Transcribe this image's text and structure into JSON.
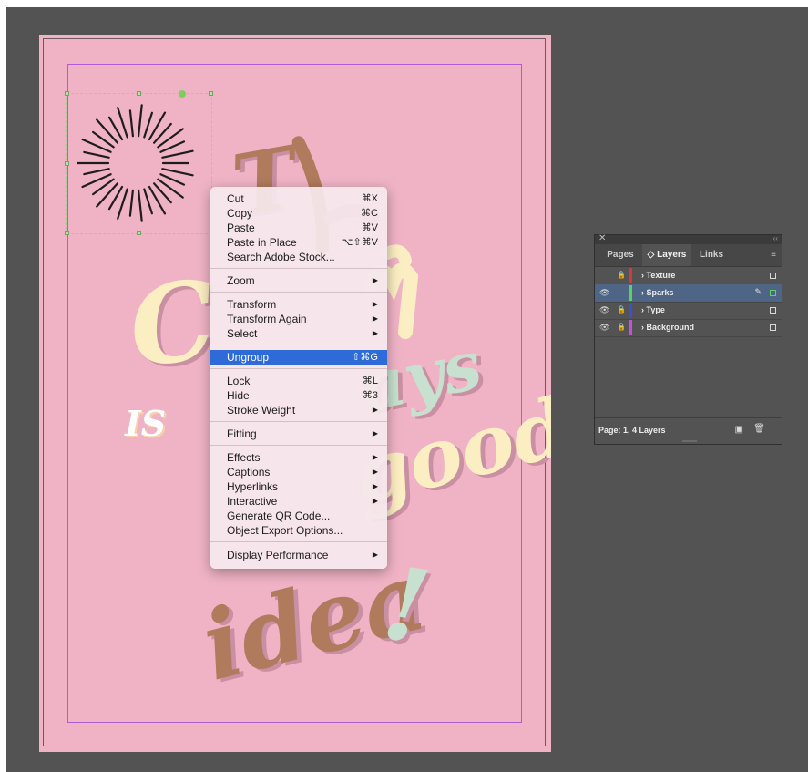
{
  "context_menu": {
    "items": [
      {
        "label": "Cut",
        "shortcut": "⌘X"
      },
      {
        "label": "Copy",
        "shortcut": "⌘C"
      },
      {
        "label": "Paste",
        "shortcut": "⌘V"
      },
      {
        "label": "Paste in Place",
        "shortcut": "⌥⇧⌘V"
      },
      {
        "label": "Search Adobe Stock..."
      },
      {
        "label": "Zoom",
        "submenu": true
      },
      {
        "label": "Transform",
        "submenu": true
      },
      {
        "label": "Transform Again",
        "submenu": true
      },
      {
        "label": "Select",
        "submenu": true
      },
      {
        "label": "Ungroup",
        "shortcut": "⇧⌘G",
        "highlighted": true
      },
      {
        "label": "Lock",
        "shortcut": "⌘L"
      },
      {
        "label": "Hide",
        "shortcut": "⌘3"
      },
      {
        "label": "Stroke Weight",
        "submenu": true
      },
      {
        "label": "Fitting",
        "submenu": true
      },
      {
        "label": "Effects",
        "submenu": true
      },
      {
        "label": "Captions",
        "submenu": true
      },
      {
        "label": "Hyperlinks",
        "submenu": true
      },
      {
        "label": "Interactive",
        "submenu": true
      },
      {
        "label": "Generate QR Code..."
      },
      {
        "label": "Object Export Options..."
      },
      {
        "label": "Display Performance",
        "submenu": true
      }
    ],
    "submenu_arrow": "▶"
  },
  "layers_panel": {
    "close_icon": "✕",
    "collapse_icon": "‹‹",
    "menu_icon": "≡",
    "tabs": [
      "Pages",
      "◇ Layers",
      "Links"
    ],
    "active_tab": "◇ Layers",
    "layers": [
      {
        "name": "Texture",
        "color": "#d13b3b",
        "visible": false,
        "locked": true,
        "selected": false
      },
      {
        "name": "Sparks",
        "color": "#5ad35a",
        "visible": true,
        "locked": false,
        "selected": true
      },
      {
        "name": "Type",
        "color": "#3a4fd6",
        "visible": true,
        "locked": true,
        "selected": false
      },
      {
        "name": "Background",
        "color": "#c84fd8",
        "visible": true,
        "locked": true,
        "selected": false
      }
    ],
    "footer": "Page: 1, 4 Layers",
    "icons": {
      "eye": "👁",
      "lock": "🔒",
      "chevron": "›",
      "pencil": "✎",
      "new_layer": "▣",
      "trash": "🗑"
    }
  },
  "artwork": {
    "page_color": "#f0b3c6",
    "cream": "#fbeec2",
    "mint": "#c8e0cf",
    "brown": "#b07a5c",
    "white": "#ffffff",
    "words": [
      "T",
      "C",
      "ays",
      "IS",
      "good",
      "idea",
      "!"
    ]
  }
}
